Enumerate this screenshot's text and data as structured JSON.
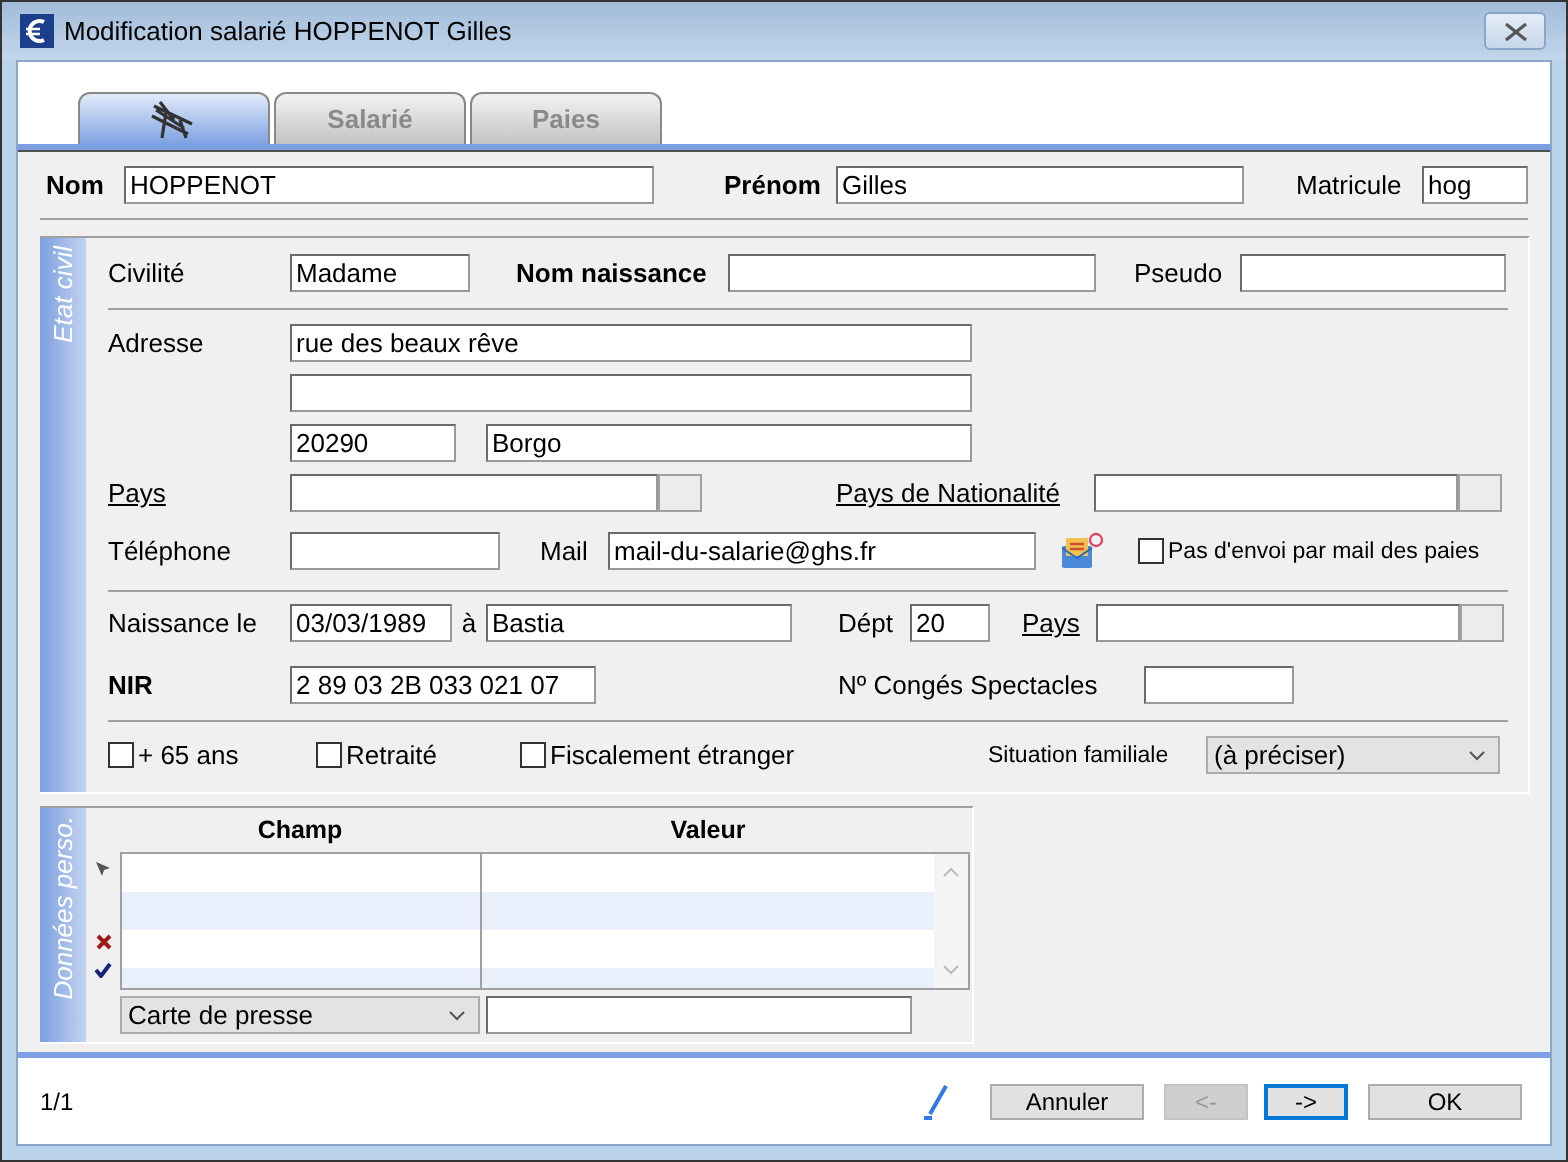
{
  "window": {
    "title": "Modification salarié HOPPENOT Gilles"
  },
  "tabs": [
    {
      "kind": "icon",
      "selected": true
    },
    {
      "kind": "text",
      "label": "Salarié",
      "selected": false
    },
    {
      "kind": "text",
      "label": "Paies",
      "selected": false
    }
  ],
  "identity": {
    "nom": {
      "label": "Nom",
      "required": true,
      "value": "HOPPENOT"
    },
    "prenom": {
      "label": "Prénom",
      "required": true,
      "value": "Gilles"
    },
    "matricule": {
      "label": "Matricule",
      "required": false,
      "value": "hog"
    }
  },
  "etat_civil": {
    "title": "Etat civil",
    "civilite": {
      "label": "Civilité",
      "value": "Madame"
    },
    "nom_naissance": {
      "label": "Nom naissance",
      "required": true
    },
    "pseudo": {
      "label": "Pseudo"
    },
    "adresse": {
      "label": "Adresse",
      "line1": "rue des beaux rêve",
      "postal_code": "20290",
      "city": "Borgo"
    },
    "pays": {
      "label": "Pays",
      "link": true
    },
    "pays_nationalite": {
      "label": "Pays de Nationalité",
      "link": true
    },
    "telephone": {
      "label": "Téléphone"
    },
    "mail": {
      "label": "Mail",
      "value": "mail-du-salarie@ghs.fr"
    },
    "no_mail": {
      "label": "Pas d'envoi par mail des paies",
      "checked": false
    },
    "naissance": {
      "label": "Naissance le",
      "value": "03/03/1989"
    },
    "lieu": {
      "label": "à",
      "value": "Bastia"
    },
    "dept": {
      "label": "Dépt",
      "value": "20"
    },
    "pays_naissance": {
      "label": "Pays",
      "link": true
    },
    "nir": {
      "label": "NIR",
      "required": true,
      "value": "2 89 03 2B 033 021 07"
    },
    "conges": {
      "label": "Nº Congés Spectacles"
    },
    "checks": [
      {
        "label": "+ 65 ans",
        "checked": false
      },
      {
        "label": "Retraité",
        "checked": false
      },
      {
        "label": "Fiscalement étranger",
        "checked": false
      }
    ],
    "situation": {
      "label": "Situation familiale",
      "value": "(à préciser)"
    }
  },
  "donnees_perso": {
    "title": "Données perso.",
    "columns": [
      "Champ",
      "Valeur"
    ],
    "field_select": {
      "value": "Carte de presse"
    }
  },
  "status": {
    "record": "1/1"
  },
  "buttons": [
    {
      "label": "Annuler",
      "disabled": false,
      "focused": false
    },
    {
      "label": "<-",
      "disabled": true,
      "focused": false
    },
    {
      "label": "->",
      "disabled": false,
      "focused": true
    },
    {
      "label": "OK",
      "disabled": false,
      "focused": false
    }
  ]
}
